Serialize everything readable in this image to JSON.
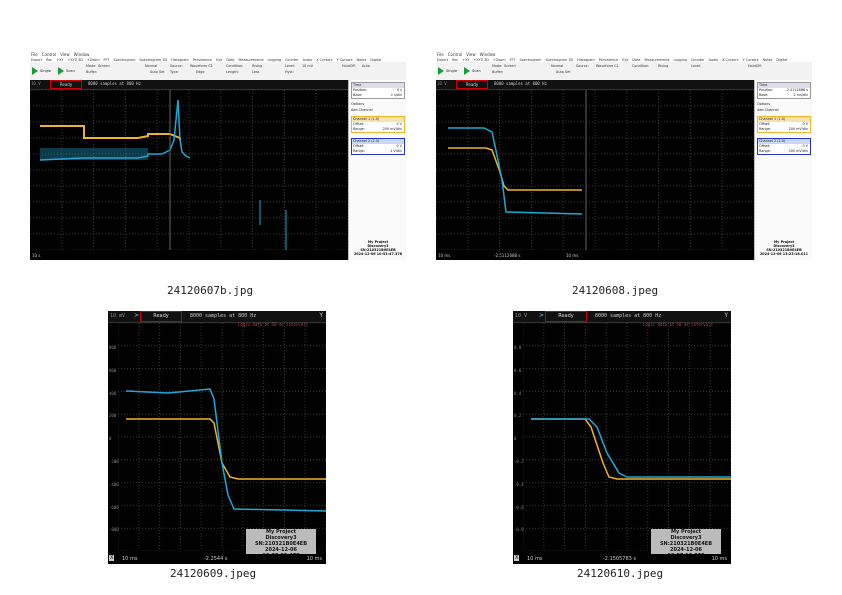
{
  "captions": [
    "24120607b.jpg",
    "24120608.jpeg",
    "24120609.jpeg",
    "24120610.jpeg"
  ],
  "app": {
    "menu": [
      "File",
      "Control",
      "View",
      "Window"
    ],
    "toolbar": [
      "Export",
      "Rec",
      "+XY",
      "+XYZ 3D",
      "+Zoom",
      "FFT",
      "Spectrogram",
      "Spectrogram 3D",
      "Histogram",
      "Persistence",
      "Eye",
      "Data",
      "Measurements",
      "Logging",
      "Counter",
      "Audio",
      "X Cursors",
      "Y Cursors",
      "Notes",
      "Digital",
      "Measurements"
    ],
    "single_label": "Single",
    "scan_label": "Scan",
    "mode_label": "Mode:",
    "mode_value": "Screen",
    "buffer_label": "Buffer:",
    "normal_label": "Normal",
    "auto_set_label": "Auto Set",
    "source_label": "Source:",
    "source_value": "Waveform C1",
    "condition_label": "Condition:",
    "condition_value": "Rising",
    "level_label": "Level:",
    "level_value": "10 mV",
    "hyst_label": "Hyst:",
    "auto_label": "Auto",
    "holdoff_label": "HoldOff:",
    "holdoff_value": "0 s",
    "type_label": "Type:",
    "edge_label": "Edge",
    "length_label": "Length:",
    "less_label": "Less",
    "status": "Ready",
    "samples_text": "8000 samples at 800 Hz",
    "logic_text": "Logic data at 50 ms intervals",
    "time_panel": {
      "title": "Time",
      "position_label": "Position:",
      "base_label": "Base:",
      "position_a": "0 s",
      "base_a": "2 s/div",
      "position_b": "-2.5112688 s",
      "base_b": "2 ms/div"
    },
    "options_label": "Options",
    "add_channel_label": "Add Channel",
    "channel1": {
      "title": "Channel 1 (1.0)",
      "offset_label": "Offset:",
      "offset": "0 V",
      "range_label": "Range:",
      "range_a": "200 mV/div",
      "range_b": "200 mV/div"
    },
    "channel2": {
      "title": "Channel 2 (2.0)",
      "offset_label": "Offset:",
      "offset": "0 V",
      "range_label": "Range:",
      "range_a": "1 V/div",
      "range_b": "200 mV/div"
    },
    "stamp_lines": [
      "My Project",
      "Discovery3",
      "SN:210321B0E4EB"
    ],
    "stamp_dates": [
      "2024-12-06 10:53:47.378",
      "2024-12-06 13:23:18.011",
      "2024-12-06 13:25:05.478",
      "2024-12-06 13:57:12.035"
    ],
    "bottom_left": [
      "10 s",
      "10 ms",
      "10 ms",
      "10 ms"
    ],
    "bottom_center": [
      "",
      "-2.5112688 s",
      "-2.2544 s",
      "-2.1505783 s"
    ],
    "bottom_right": [
      "",
      "10 ms",
      "10 ms",
      "10 ms"
    ],
    "top_left_units": [
      "10 V",
      "10 V",
      "10 mV",
      "10 V"
    ],
    "y_labels_c": [
      "800",
      "600",
      "400",
      "200",
      "0",
      "-200",
      "-400",
      "-600",
      "-800"
    ],
    "y_labels_d": [
      "0.8",
      "0.6",
      "0.4",
      "0.2",
      "0",
      "-0.2",
      "-0.4",
      "-0.6",
      "-0.8"
    ],
    "colors": {
      "ch1": "#f0b428",
      "ch2": "#21a8d6",
      "grid": "#3a3a3a",
      "ready_border": "#cc0000"
    }
  }
}
